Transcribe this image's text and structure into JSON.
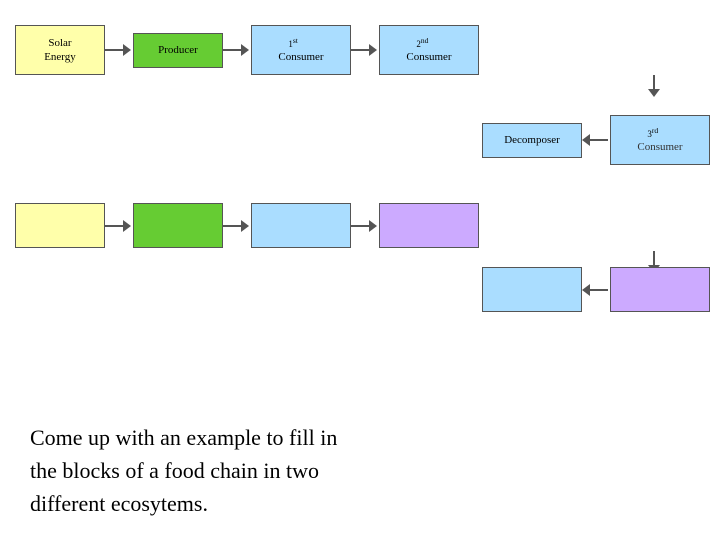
{
  "diagram": {
    "row1": {
      "solar_energy": "Solar\nEnergy",
      "producer": "Producer",
      "consumer1_sup": "1",
      "consumer1_sup_text": "st",
      "consumer1": "Consumer",
      "consumer2_sup": "2",
      "consumer2_sup_text": "nd",
      "consumer2": "Consumer"
    },
    "row2": {
      "decomposer": "Decomposer",
      "consumer3_sup": "3",
      "consumer3_sup_text": "rd",
      "consumer3": "Consumer"
    },
    "colors": {
      "solar": "#ffffaa",
      "producer": "#66cc33",
      "consumer1": "#aaddff",
      "consumer2": "#aaddff",
      "decomposer": "#aaddff",
      "consumer3": "#ccaaff",
      "blank_yellow": "#ffffaa",
      "blank_green": "#66cc33",
      "blank_blue": "#aaddff",
      "blank_purple": "#ccaaff"
    }
  },
  "text": {
    "line1": "Come up with an example to fill in",
    "line2": "the blocks of a food chain in two",
    "line3": "different ecosytems."
  }
}
